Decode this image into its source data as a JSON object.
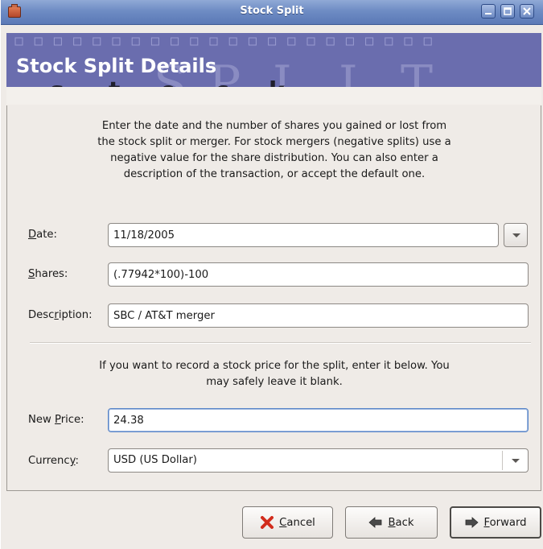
{
  "window": {
    "title": "Stock Split",
    "icon": "briefcase-icon",
    "controls": [
      "minimize-icon",
      "maximize-icon",
      "close-icon"
    ]
  },
  "banner": {
    "title": "Stock Split Details",
    "watermark": "SPLIT",
    "watermark_small": "s t o c k"
  },
  "intro_text": "Enter the date and the number of shares you gained or lost from the stock split or merger. For stock mergers (negative splits) use a negative value for the share distribution. You can also enter a description of the transaction, or accept the default one.",
  "fields": {
    "date": {
      "label_pre": "",
      "label_mnemonic": "D",
      "label_post": "ate:",
      "value": "11/18/2005"
    },
    "shares": {
      "label_pre": "",
      "label_mnemonic": "S",
      "label_post": "hares:",
      "value": "(.77942*100)-100"
    },
    "description": {
      "label_pre": "Desc",
      "label_mnemonic": "r",
      "label_post": "iption:",
      "value": "SBC / AT&T merger"
    }
  },
  "price_text": "If you want to record a stock price for the split, enter it below. You may safely leave it blank.",
  "price": {
    "new_price": {
      "label_pre": "New ",
      "label_mnemonic": "P",
      "label_post": "rice:",
      "value": "24.38"
    },
    "currency": {
      "label_pre": "Currenc",
      "label_mnemonic": "y",
      "label_post": ":",
      "value": "USD (US Dollar)"
    }
  },
  "buttons": {
    "cancel": {
      "pre": "",
      "mnemonic": "C",
      "post": "ancel",
      "icon": "cancel-x-icon"
    },
    "back": {
      "pre": "",
      "mnemonic": "B",
      "post": "ack",
      "icon": "back-arrow-icon"
    },
    "forward": {
      "pre": "",
      "mnemonic": "F",
      "post": "orward",
      "icon": "forward-arrow-icon"
    }
  },
  "colors": {
    "banner_bg": "#6a6dae",
    "titlebar": "#6e8cc4",
    "cancel_icon": "#d22c1c"
  }
}
